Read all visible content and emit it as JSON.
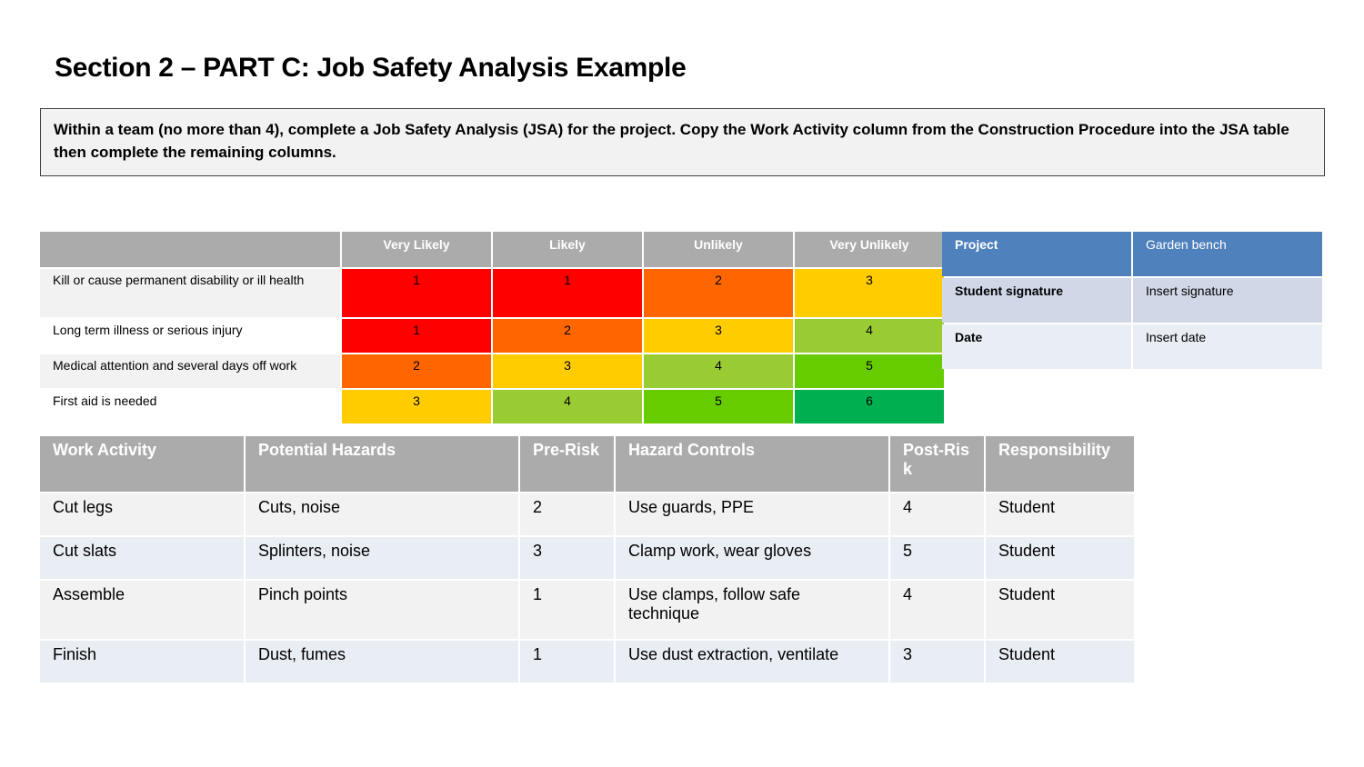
{
  "title": "Section 2 – PART C: Job Safety Analysis Example",
  "instructions": "Within a team (no more than 4), complete a Job Safety Analysis (JSA) for the project. Copy the Work Activity column from the Construction Procedure into the JSA table then complete the remaining columns.",
  "risk_matrix": {
    "columns": [
      "Very Likely",
      "Likely",
      "Unlikely",
      "Very Unlikely"
    ],
    "rows": [
      {
        "label": "Kill or cause permanent disability or ill health",
        "values": [
          "1",
          "1",
          "2",
          "3"
        ],
        "colors": [
          "#ff0000",
          "#ff0000",
          "#ff6600",
          "#ffcc00"
        ]
      },
      {
        "label": "Long term illness or serious injury",
        "values": [
          "1",
          "2",
          "3",
          "4"
        ],
        "colors": [
          "#ff0000",
          "#ff6600",
          "#ffcc00",
          "#99cc33"
        ]
      },
      {
        "label": "Medical attention and several days off work",
        "values": [
          "2",
          "3",
          "4",
          "5"
        ],
        "colors": [
          "#ff6600",
          "#ffcc00",
          "#99cc33",
          "#66cc00"
        ]
      },
      {
        "label": "First aid is needed",
        "values": [
          "3",
          "4",
          "5",
          "6"
        ],
        "colors": [
          "#ffcc00",
          "#99cc33",
          "#66cc00",
          "#00b050"
        ]
      }
    ]
  },
  "project_info": {
    "project_label": "Project",
    "project_value": "Garden bench",
    "signature_label": "Student signature",
    "signature_value": "Insert signature",
    "date_label": "Date",
    "date_value": "Insert date"
  },
  "jsa": {
    "headers": [
      "Work Activity",
      "Potential Hazards",
      "Pre-Risk",
      "Hazard Controls",
      "Post-Risk",
      "Responsibility"
    ],
    "rows": [
      [
        "Cut legs",
        "Cuts, noise",
        "2",
        "Use guards, PPE",
        "4",
        "Student"
      ],
      [
        "Cut slats",
        "Splinters, noise",
        "3",
        "Clamp work, wear gloves",
        "5",
        "Student"
      ],
      [
        "Assemble",
        "Pinch points",
        "1",
        "Use clamps, follow safe technique",
        "4",
        "Student"
      ],
      [
        "Finish",
        "Dust, fumes",
        "1",
        "Use dust extraction, ventilate",
        "3",
        "Student"
      ]
    ]
  }
}
